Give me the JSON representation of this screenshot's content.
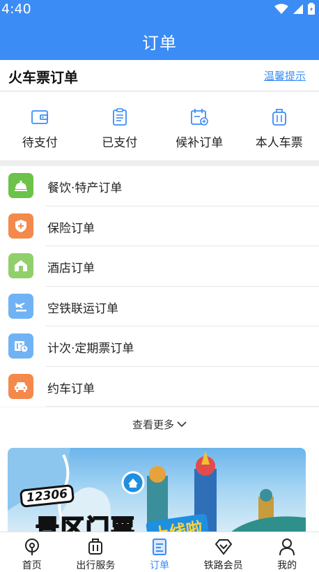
{
  "status_bar": {
    "time": "4:40"
  },
  "header": {
    "title": "订单"
  },
  "section": {
    "title": "火车票订单",
    "tips_link": "温馨提示"
  },
  "status_items": [
    {
      "label": "待支付",
      "icon": "wallet-icon"
    },
    {
      "label": "已支付",
      "icon": "receipt-icon"
    },
    {
      "label": "候补订单",
      "icon": "calendar-add-icon"
    },
    {
      "label": "本人车票",
      "icon": "luggage-icon"
    }
  ],
  "orders": [
    {
      "label": "餐饮·特产订单",
      "icon": "dining-bell-icon",
      "color": "#6cc24a"
    },
    {
      "label": "保险订单",
      "icon": "shield-plus-icon",
      "color": "#f38a4b"
    },
    {
      "label": "酒店订单",
      "icon": "hotel-icon",
      "color": "#8fd06a"
    },
    {
      "label": "空铁联运订单",
      "icon": "plane-train-icon",
      "color": "#6fb3f5"
    },
    {
      "label": "计次·定期票订单",
      "icon": "ticket-clock-icon",
      "color": "#6fb3f5"
    },
    {
      "label": "约车订单",
      "icon": "car-icon",
      "color": "#f38a4b"
    }
  ],
  "more": {
    "label": "查看更多"
  },
  "banner": {
    "badge": "12306",
    "headline": "景区门票",
    "tag": "上线啦"
  },
  "tabs": [
    {
      "label": "首页",
      "icon": "home-train-icon",
      "active": false
    },
    {
      "label": "出行服务",
      "icon": "suitcase-icon",
      "active": false
    },
    {
      "label": "订单",
      "icon": "order-doc-icon",
      "active": true
    },
    {
      "label": "铁路会员",
      "icon": "diamond-icon",
      "active": false
    },
    {
      "label": "我的",
      "icon": "user-icon",
      "active": false
    }
  ],
  "colors": {
    "primary": "#3b8cf5"
  }
}
